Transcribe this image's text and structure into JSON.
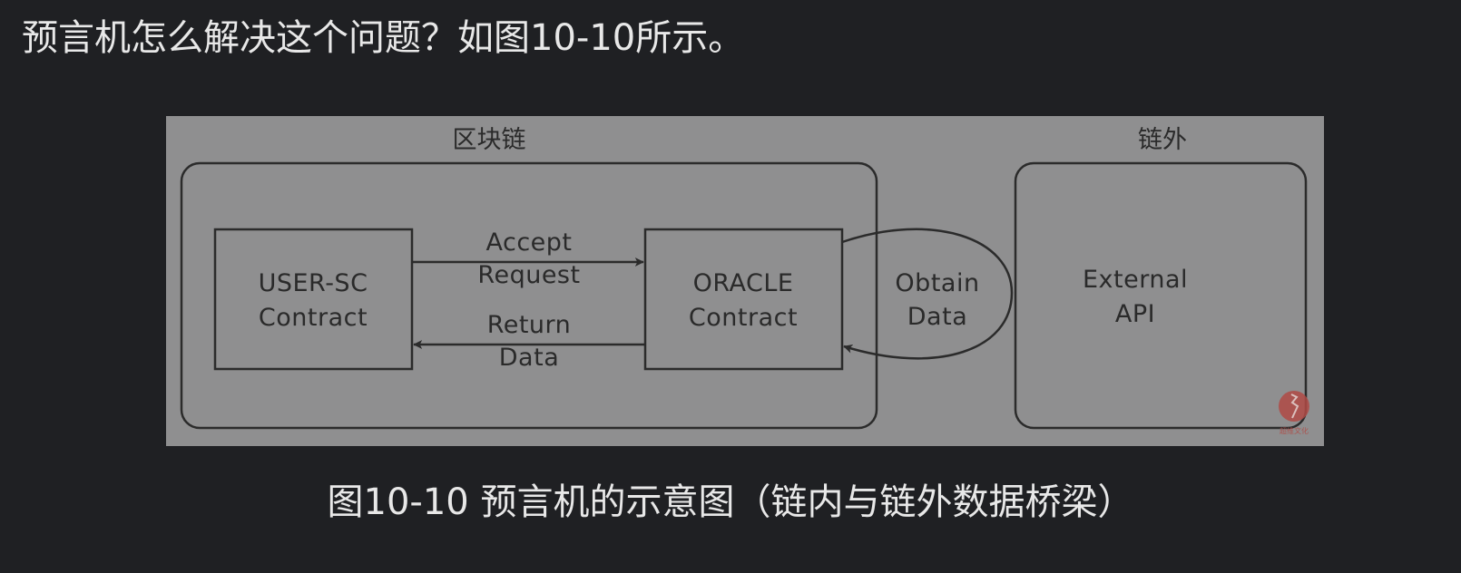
{
  "question_text": "预言机怎么解决这个问题？如图10-10所示。",
  "diagram": {
    "region_onchain": "区块链",
    "region_offchain": "链外",
    "user_contract": {
      "line1": "USER-SC",
      "line2": "Contract"
    },
    "oracle_contract": {
      "line1": "ORACLE",
      "line2": "Contract"
    },
    "external_api": {
      "line1": "External",
      "line2": "API"
    },
    "edge_accept": {
      "line1": "Accept",
      "line2": "Request"
    },
    "edge_return": {
      "line1": "Return",
      "line2": "Data"
    },
    "edge_obtain": {
      "line1": "Obtain",
      "line2": "Data"
    },
    "watermark_text": "超维文化"
  },
  "caption": "图10-10 预言机的示意图（链内与链外数据桥梁）"
}
